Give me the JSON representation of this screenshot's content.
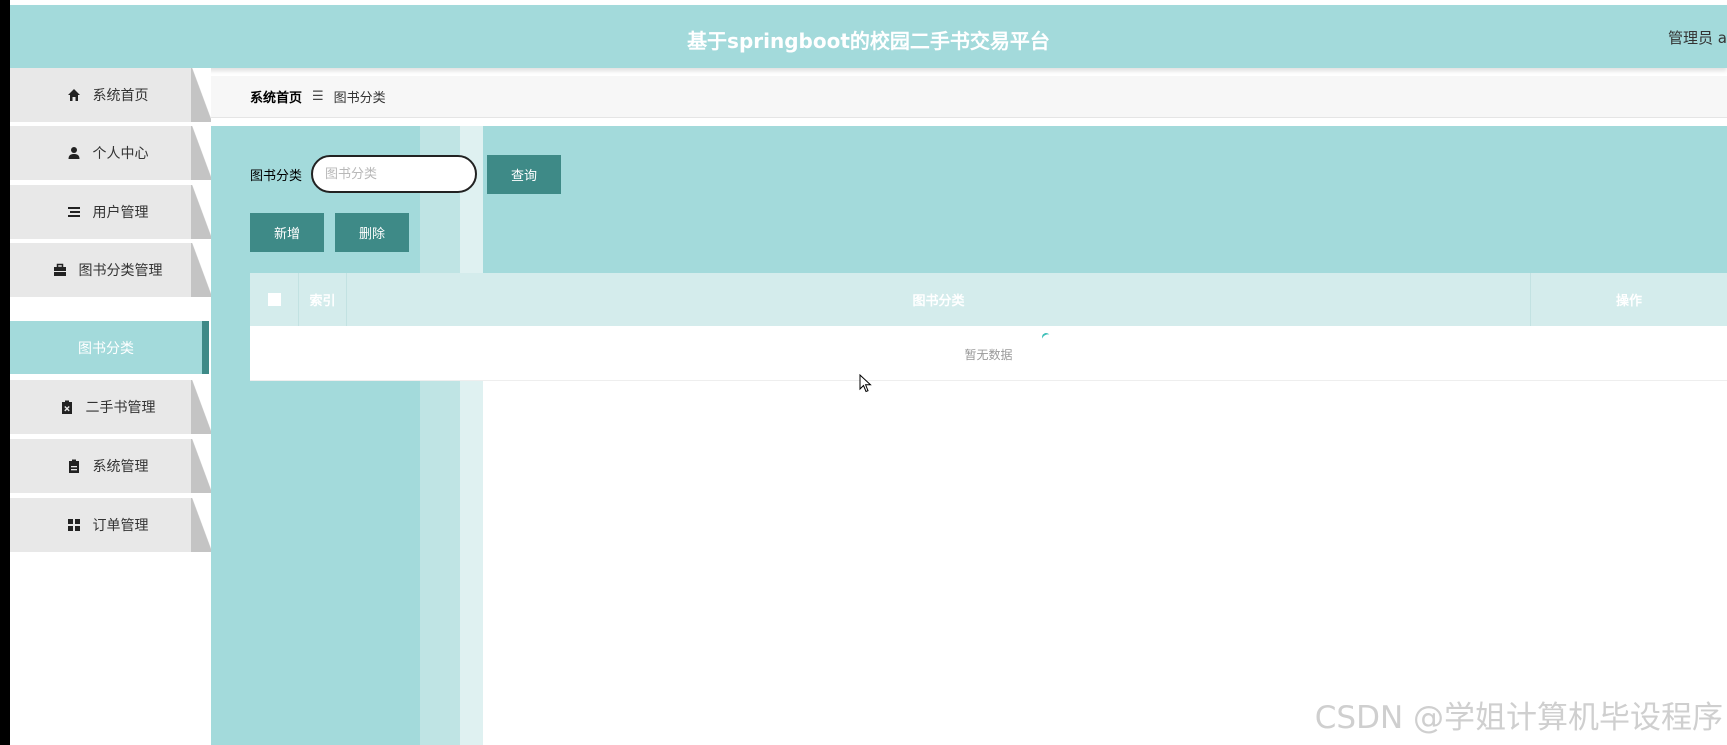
{
  "header": {
    "title": "基于springboot的校园二手书交易平台",
    "user_label": "管理员 a"
  },
  "sidebar": {
    "items": [
      {
        "label": "系统首页",
        "icon": "home-icon"
      },
      {
        "label": "个人中心",
        "icon": "user-icon"
      },
      {
        "label": "用户管理",
        "icon": "list-icon"
      },
      {
        "label": "图书分类管理",
        "icon": "briefcase-icon"
      },
      {
        "label": "二手书管理",
        "icon": "clipboard-x-icon"
      },
      {
        "label": "系统管理",
        "icon": "clipboard-icon"
      },
      {
        "label": "订单管理",
        "icon": "grid-icon"
      }
    ],
    "active_sub": {
      "label": "图书分类"
    }
  },
  "breadcrumb": {
    "home": "系统首页",
    "separator": "☰",
    "current": "图书分类"
  },
  "search": {
    "label": "图书分类",
    "placeholder": "图书分类",
    "value": "",
    "button": "查询"
  },
  "actions": {
    "add": "新增",
    "delete": "删除"
  },
  "table": {
    "columns": [
      "索引",
      "图书分类",
      "操作"
    ],
    "empty_text": "暂无数据"
  },
  "watermark": "CSDN @学姐计算机毕设程序",
  "colors": {
    "theme": "#a3dadb",
    "button": "#3e8a87",
    "active_border": "#3e8a87",
    "header_row": "#d4ecec"
  }
}
